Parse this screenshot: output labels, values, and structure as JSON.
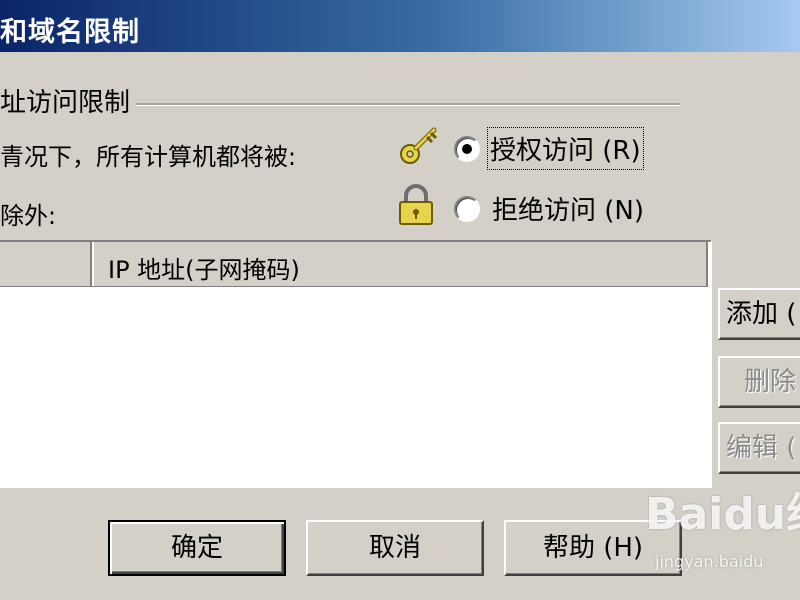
{
  "window": {
    "title": "和域名限制"
  },
  "group": {
    "label": "址访问限制"
  },
  "policy": {
    "default_text": "青况下，所有计算机都将被:",
    "except_text": "除外:",
    "grant_label": "授权访问 (R)",
    "deny_label": "拒绝访问 (N)",
    "selected": "grant",
    "grant_icon": "key-icon",
    "deny_icon": "lock-icon"
  },
  "list": {
    "columns": [
      "",
      "IP 地址(子网掩码)"
    ],
    "rows": []
  },
  "side_buttons": {
    "add": "添加 (",
    "remove": "删除",
    "edit": "编辑 ("
  },
  "footer": {
    "ok": "确定",
    "cancel": "取消",
    "help": "帮助 (H)"
  },
  "watermark": {
    "main": "Baidu经",
    "sub": "jingyan.baidu"
  }
}
